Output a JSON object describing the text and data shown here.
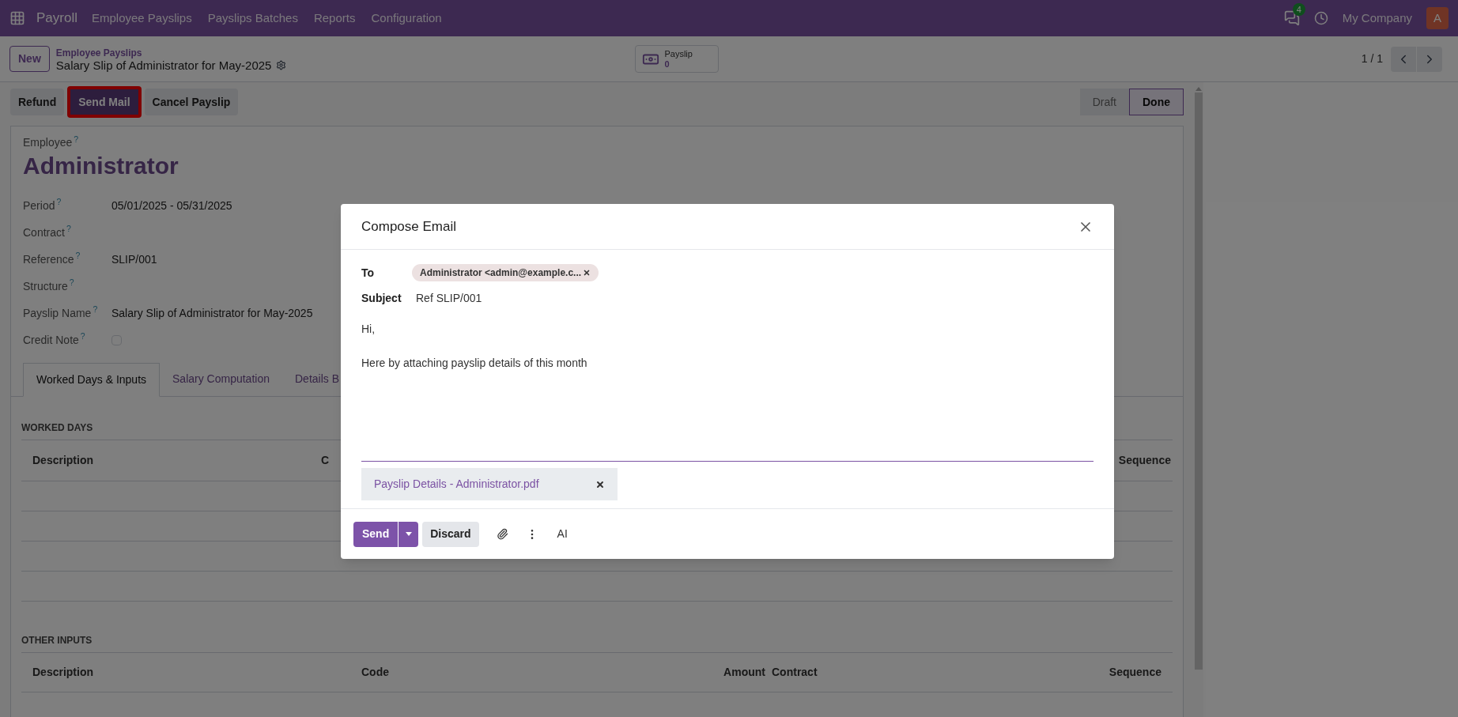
{
  "navbar": {
    "app": "Payroll",
    "menu": [
      "Employee Payslips",
      "Payslips Batches",
      "Reports",
      "Configuration"
    ],
    "messages_count": "4",
    "company": "My Company",
    "avatar": "A"
  },
  "control_panel": {
    "new_button": "New",
    "breadcrumb": "Employee Payslips",
    "title": "Salary Slip of Administrator for May-2025",
    "smart_button": {
      "label": "Payslip",
      "count": "0"
    },
    "pager": "1 / 1"
  },
  "action_buttons": [
    {
      "label": "Refund",
      "highlighted": false
    },
    {
      "label": "Send Mail",
      "highlighted": true
    },
    {
      "label": "Cancel Payslip",
      "highlighted": false
    }
  ],
  "stages": [
    {
      "label": "Draft",
      "selected": false
    },
    {
      "label": "Done",
      "selected": true
    }
  ],
  "form": {
    "employee_label": "Employee",
    "employee_help": "?",
    "employee": "Administrator",
    "fields": [
      {
        "label": "Period",
        "help": "?",
        "kind": "text",
        "value": "05/01/2025 - 05/31/2025"
      },
      {
        "label": "Contract",
        "help": "?",
        "kind": "text"
      },
      {
        "label": "Reference",
        "help": "?",
        "kind": "text",
        "value": "SLIP/001"
      },
      {
        "label": "Structure",
        "help": "?",
        "kind": "text"
      },
      {
        "label": "Payslip Name",
        "help": "?",
        "kind": "text",
        "value": "Salary Slip of Administrator for May-2025"
      },
      {
        "label": "Credit Note",
        "help": "?",
        "kind": "checkbox",
        "checked": false
      }
    ]
  },
  "tabs": [
    {
      "label": "Worked Days & Inputs",
      "selected": true
    },
    {
      "label": "Salary Computation",
      "selected": false
    },
    {
      "label": "Details B",
      "selected": false
    }
  ],
  "worked_days": {
    "title": "WORKED DAYS",
    "columns": [
      "Description",
      "C",
      "Sequence"
    ]
  },
  "other_inputs": {
    "title": "OTHER INPUTS",
    "columns": [
      "Description",
      "Code",
      "Amount",
      "Contract",
      "Sequence"
    ]
  },
  "dialog": {
    "title": "Compose Email",
    "to_label": "To",
    "recipient": "Administrator <admin@example.c...",
    "subject_label": "Subject",
    "subject": "Ref SLIP/001",
    "body": [
      "Hi,",
      "Here by attaching payslip details of this month"
    ],
    "attachment": "Payslip Details - Administrator.pdf",
    "send": "Send",
    "discard": "Discard",
    "ai": "AI"
  }
}
